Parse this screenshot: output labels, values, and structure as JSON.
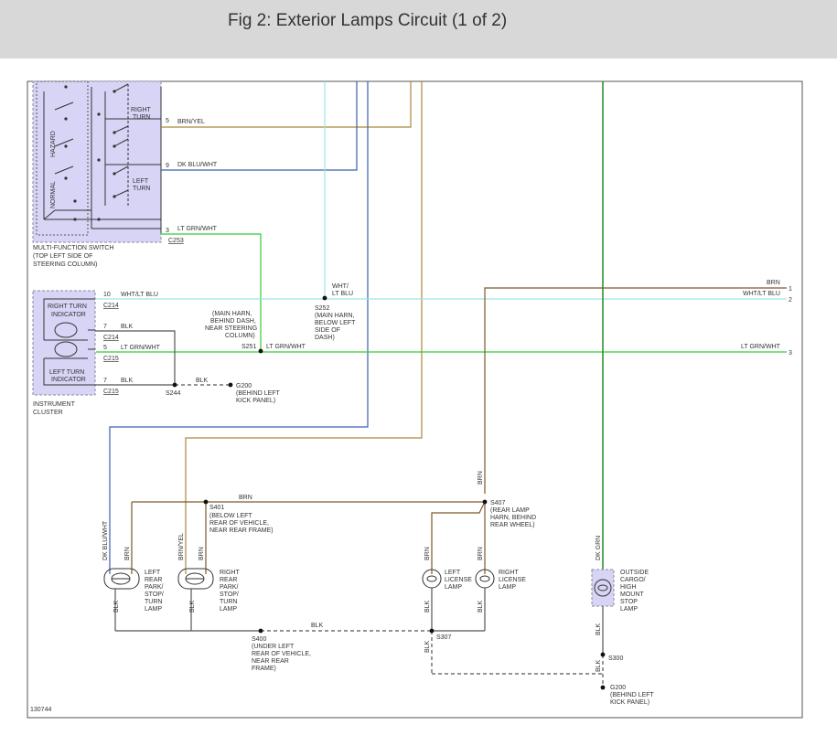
{
  "header": {
    "title": "Fig 2: Exterior Lamps Circuit (1 of 2)"
  },
  "colors": {
    "brn_yel": "#a8893a",
    "dk_blu_wht": "#3c5fae",
    "lt_grn_wht": "#33cc33",
    "wht_lt_blu": "#9fe3e3",
    "brn": "#7a5a2a",
    "blk": "#555555",
    "dk_grn": "#228b22",
    "component_fill": "#d7d4f5",
    "component_border": "#8a8aa0"
  },
  "switch": {
    "title_lines": [
      "MULTI-FUNCTION SWITCH",
      "(TOP LEFT SIDE OF",
      "STEERING COLUMN)"
    ],
    "hazard": "HAZARD",
    "normal": "NORMAL",
    "right_turn_lines": [
      "RIGHT",
      "TURN"
    ],
    "left_turn_lines": [
      "LEFT",
      "TURN"
    ],
    "connector": "C253",
    "pins": [
      {
        "pin": "5",
        "wire": "BRN/YEL"
      },
      {
        "pin": "9",
        "wire": "DK BLU/WHT"
      },
      {
        "pin": "3",
        "wire": "LT GRN/WHT"
      }
    ]
  },
  "cluster": {
    "title_lines": [
      "INSTRUMENT",
      "CLUSTER"
    ],
    "right_indicator_lines": [
      "RIGHT TURN",
      "INDICATOR"
    ],
    "left_indicator_lines": [
      "LEFT TURN",
      "INDICATOR"
    ],
    "pins": [
      {
        "pin": "10",
        "wire": "WHT/LT BLU",
        "connector": "C214"
      },
      {
        "pin": "7",
        "wire": "BLK",
        "connector": "C214"
      },
      {
        "pin": "5",
        "wire": "LT GRN/WHT",
        "connector": "C215"
      },
      {
        "pin": "7",
        "wire": "BLK",
        "connector": "C215"
      }
    ]
  },
  "splices": {
    "s252": {
      "id": "S252",
      "lines": [
        "(MAIN HARN,",
        "BELOW LEFT",
        "SIDE OF",
        "DASH)"
      ],
      "wire_lines": [
        "WHT/",
        "LT BLU"
      ]
    },
    "s251": {
      "id": "S251",
      "lines": [
        "(MAIN HARN,",
        "BEHIND DASH,",
        "NEAR STEERING",
        "COLUMN)"
      ],
      "wire": "LT GRN/WHT"
    },
    "s244": {
      "id": "S244",
      "wire": "BLK"
    },
    "g200_top": {
      "id": "G200",
      "lines": [
        "(BEHIND LEFT",
        "KICK PANEL)"
      ]
    },
    "s401": {
      "id": "S401",
      "lines": [
        "(BELOW LEFT",
        "REAR OF VEHICLE,",
        "NEAR REAR FRAME)"
      ]
    },
    "s407": {
      "id": "S407",
      "lines": [
        "(REAR LAMP",
        "HARN, BEHIND",
        "REAR WHEEL)"
      ]
    },
    "s400": {
      "id": "S400",
      "lines": [
        "(UNDER LEFT",
        "REAR OF VEHICLE,",
        "NEAR REAR",
        "FRAME)"
      ]
    },
    "s307": {
      "id": "S307"
    },
    "s300": {
      "id": "S300"
    },
    "g200_bottom": {
      "id": "G200",
      "lines": [
        "(BEHIND LEFT",
        "KICK PANEL)"
      ]
    }
  },
  "right_edge": [
    {
      "wire": "BRN",
      "pin": "1"
    },
    {
      "wire": "WHT/LT BLU",
      "pin": "2"
    },
    {
      "wire": "LT GRN/WHT",
      "pin": "3"
    }
  ],
  "wires": {
    "brn": "BRN",
    "blk": "BLK",
    "dk_blu_wht": "DK BLU/WHT",
    "brn_yel": "BRN/YEL",
    "dk_grn": "DK GRN"
  },
  "lamps": {
    "left_rear": [
      "LEFT",
      "REAR",
      "PARK/",
      "STOP/",
      "TURN",
      "LAMP"
    ],
    "right_rear": [
      "RIGHT",
      "REAR",
      "PARK/",
      "STOP/",
      "TURN",
      "LAMP"
    ],
    "left_license": [
      "LEFT",
      "LICENSE",
      "LAMP"
    ],
    "right_license": [
      "RIGHT",
      "LICENSE",
      "LAMP"
    ],
    "cargo": [
      "OUTSIDE",
      "CARGO/",
      "HIGH",
      "MOUNT",
      "STOP",
      "LAMP"
    ]
  },
  "figure_number": "130744"
}
